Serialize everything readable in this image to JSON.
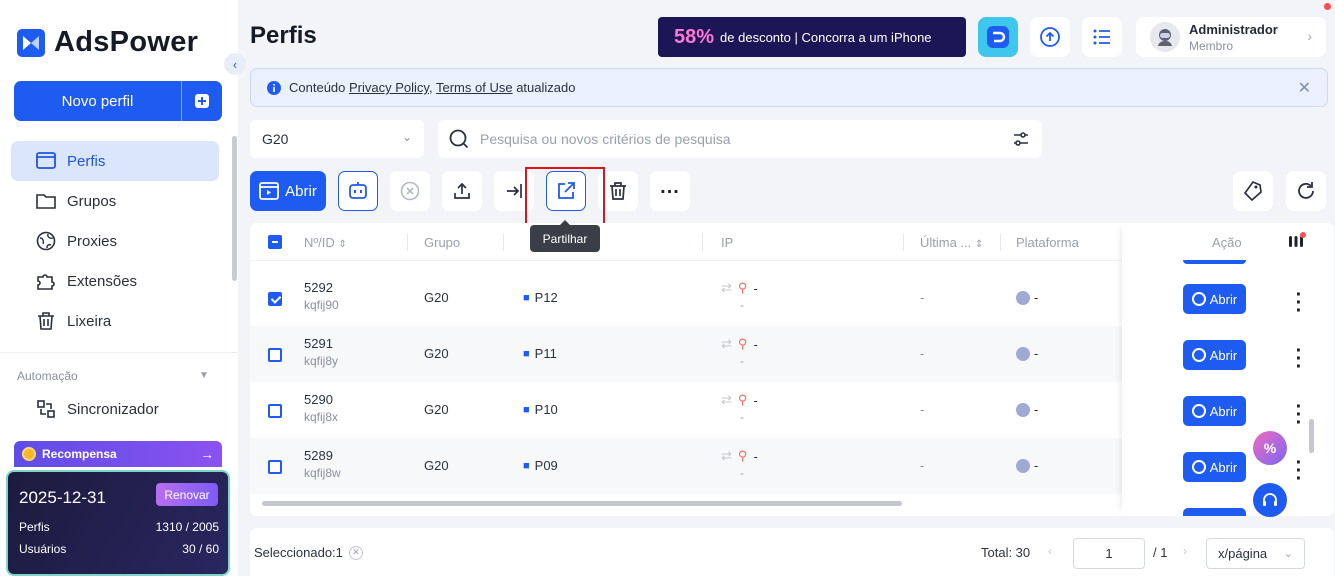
{
  "app": {
    "brand": "AdsPower"
  },
  "sidebar": {
    "new_profile_label": "Novo perfil",
    "items": [
      {
        "label": "Perfis",
        "icon": "profiles-icon",
        "active": true
      },
      {
        "label": "Grupos",
        "icon": "folder-icon"
      },
      {
        "label": "Proxies",
        "icon": "globe-icon"
      },
      {
        "label": "Extensões",
        "icon": "puzzle-icon"
      },
      {
        "label": "Lixeira",
        "icon": "trash-icon"
      }
    ],
    "section_automation": "Automação",
    "sync_label": "Sincronizador",
    "reward_label": "Recompensa",
    "plan": {
      "expiry": "2025-12-31",
      "renew_label": "Renovar",
      "profiles_label": "Perfis",
      "profiles_value": "1310 / 2005",
      "users_label": "Usuários",
      "users_value": "30 / 60"
    }
  },
  "header": {
    "title": "Perfis",
    "promo_pct": "58%",
    "promo_text": "de desconto | Concorra a um iPhone",
    "user_name": "Administrador",
    "user_role": "Membro"
  },
  "notice": {
    "prefix": "Conteúdo",
    "link1": "Privacy Policy",
    "comma": ",",
    "link2": "Terms of Use",
    "suffix": "atualizado"
  },
  "filters": {
    "group_value": "G20",
    "search_placeholder": "Pesquisa ou novos critérios de pesquisa"
  },
  "toolbar": {
    "open_label": "Abrir",
    "tooltip": "Partilhar"
  },
  "table": {
    "headers": {
      "id": "Nº/ID",
      "group": "Grupo",
      "ip": "IP",
      "last": "Última ...",
      "platform": "Plataforma",
      "action": "Ação"
    },
    "rows": [
      {
        "id": "5292",
        "sub": "kqfij90",
        "group": "G20",
        "name": "P12",
        "ip": "-",
        "ipsub": "-",
        "last": "-",
        "platform": "-",
        "action": "Abrir",
        "checked": true
      },
      {
        "id": "5291",
        "sub": "kqfij8y",
        "group": "G20",
        "name": "P11",
        "ip": "-",
        "ipsub": "-",
        "last": "-",
        "platform": "-",
        "action": "Abrir",
        "checked": false
      },
      {
        "id": "5290",
        "sub": "kqfij8x",
        "group": "G20",
        "name": "P10",
        "ip": "-",
        "ipsub": "-",
        "last": "-",
        "platform": "-",
        "action": "Abrir",
        "checked": false
      },
      {
        "id": "5289",
        "sub": "kqfij8w",
        "group": "G20",
        "name": "P09",
        "ip": "-",
        "ipsub": "-",
        "last": "-",
        "platform": "-",
        "action": "Abrir",
        "checked": false
      }
    ]
  },
  "footer": {
    "selected": "Seleccionado:1",
    "total": "Total: 30",
    "page": "1",
    "of": "/ 1",
    "per_page": "x/página"
  },
  "colors": {
    "primary": "#1e5bf0",
    "highlight": "#e0121c"
  }
}
